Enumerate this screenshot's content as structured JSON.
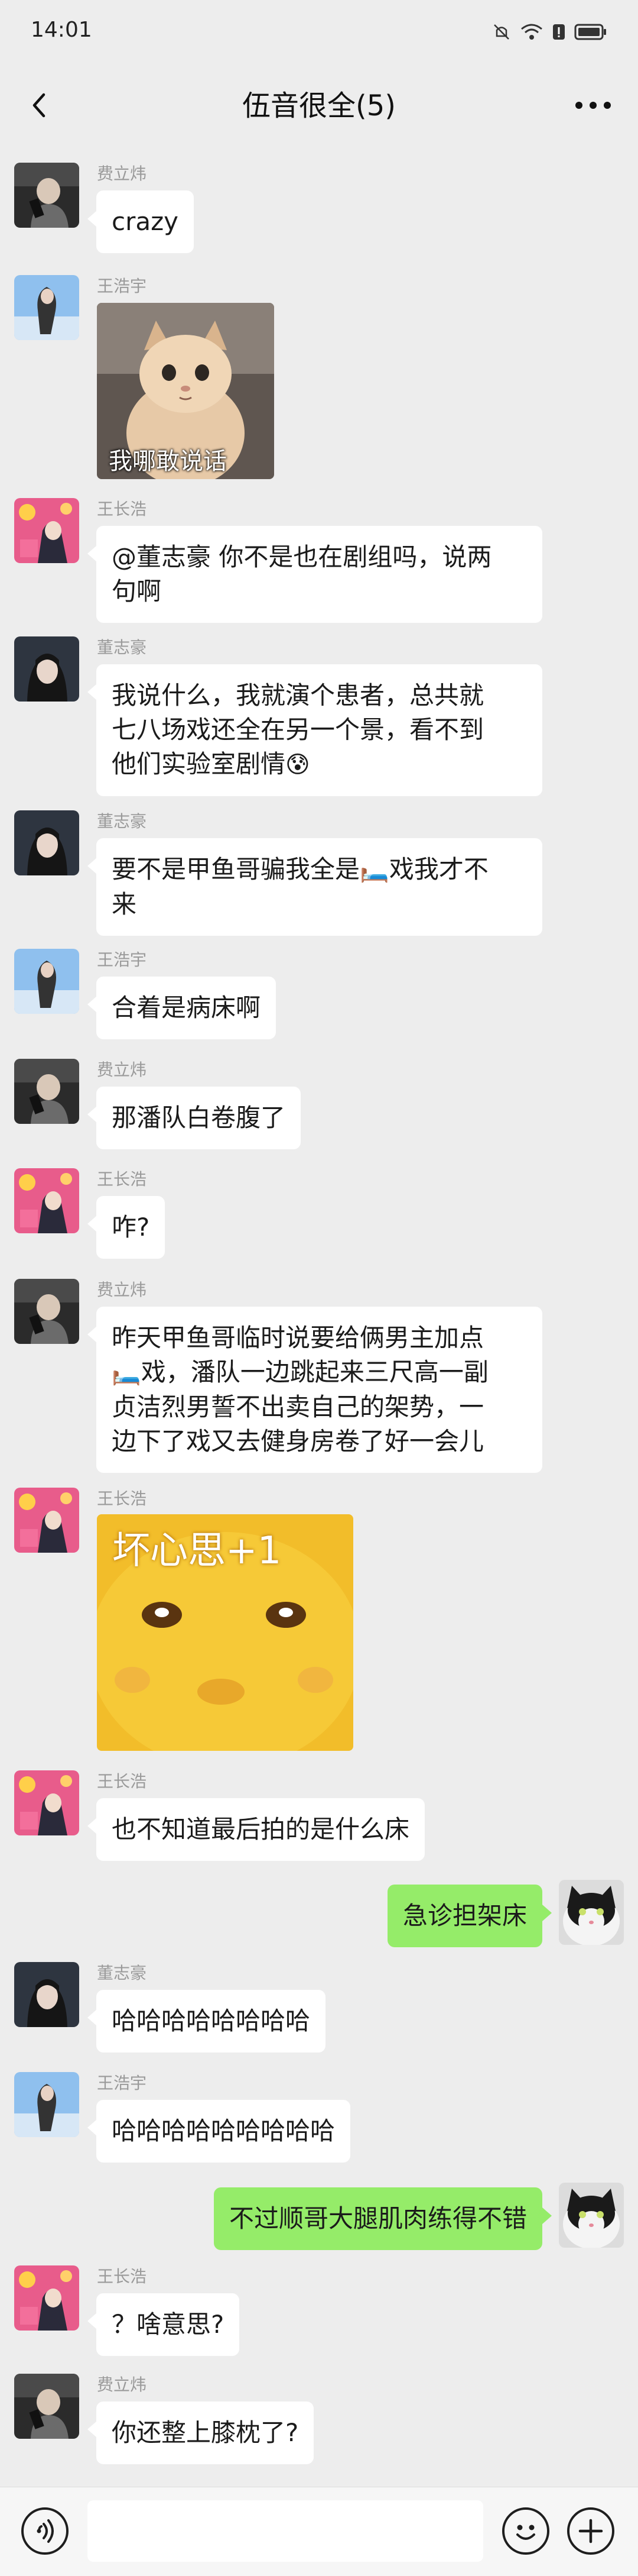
{
  "status_bar": {
    "time": "14:01"
  },
  "chat": {
    "title": "伍音很全(5)"
  },
  "messages": [
    {
      "sender": "费立炜",
      "text": "crazy"
    },
    {
      "sender": "王浩宇",
      "sticker_caption": "我哪敢说话"
    },
    {
      "sender": "王长浩",
      "lines": [
        "@董志豪 你不是也在剧组吗，说两",
        "句啊"
      ]
    },
    {
      "sender": "董志豪",
      "lines": [
        "我说什么，我就演个患者，总共就",
        "七八场戏还全在另一个景，看不到",
        "他们实验室剧情"
      ],
      "emoji": "😰"
    },
    {
      "sender": "董志豪",
      "lines_a": "要不是甲鱼哥骗我全是",
      "bed_emoji": "🛏️",
      "lines_b": "戏我才不",
      "line2": "来"
    },
    {
      "sender": "王浩宇",
      "text": "合着是病床啊"
    },
    {
      "sender": "费立炜",
      "text": "那潘队白卷腹了"
    },
    {
      "sender": "王长浩",
      "text": "咋?"
    },
    {
      "sender": "费立炜",
      "line1": "昨天甲鱼哥临时说要给俩男主加点",
      "bed_emoji": "🛏️",
      "line2": "戏，潘队一边跳起来三尺高一副",
      "line3": "贞洁烈男誓不出卖自己的架势，一",
      "line4": "边下了戏又去健身房卷了好一会儿"
    },
    {
      "sender": "王长浩",
      "sticker_caption": "坏心思+1"
    },
    {
      "sender": "王长浩",
      "text": "也不知道最后拍的是什么床"
    },
    {
      "sender": "",
      "text": "急诊担架床"
    },
    {
      "sender": "董志豪",
      "text": "哈哈哈哈哈哈哈哈"
    },
    {
      "sender": "王浩宇",
      "text": "哈哈哈哈哈哈哈哈哈"
    },
    {
      "sender": "",
      "text": "不过顺哥大腿肌肉练得不错"
    },
    {
      "sender": "王长浩",
      "text": "？啥意思?"
    },
    {
      "sender": "费立炜",
      "text": "你还整上膝枕了?"
    }
  ],
  "colors": {
    "background": "#ededed",
    "bubble_self": "#95ec69",
    "bubble_other": "#ffffff"
  },
  "icons": [
    "back-arrow-icon",
    "more-dots-icon",
    "voice-icon",
    "emoji-icon",
    "plus-icon",
    "wifi-icon",
    "battery-icon",
    "mute-icon"
  ]
}
